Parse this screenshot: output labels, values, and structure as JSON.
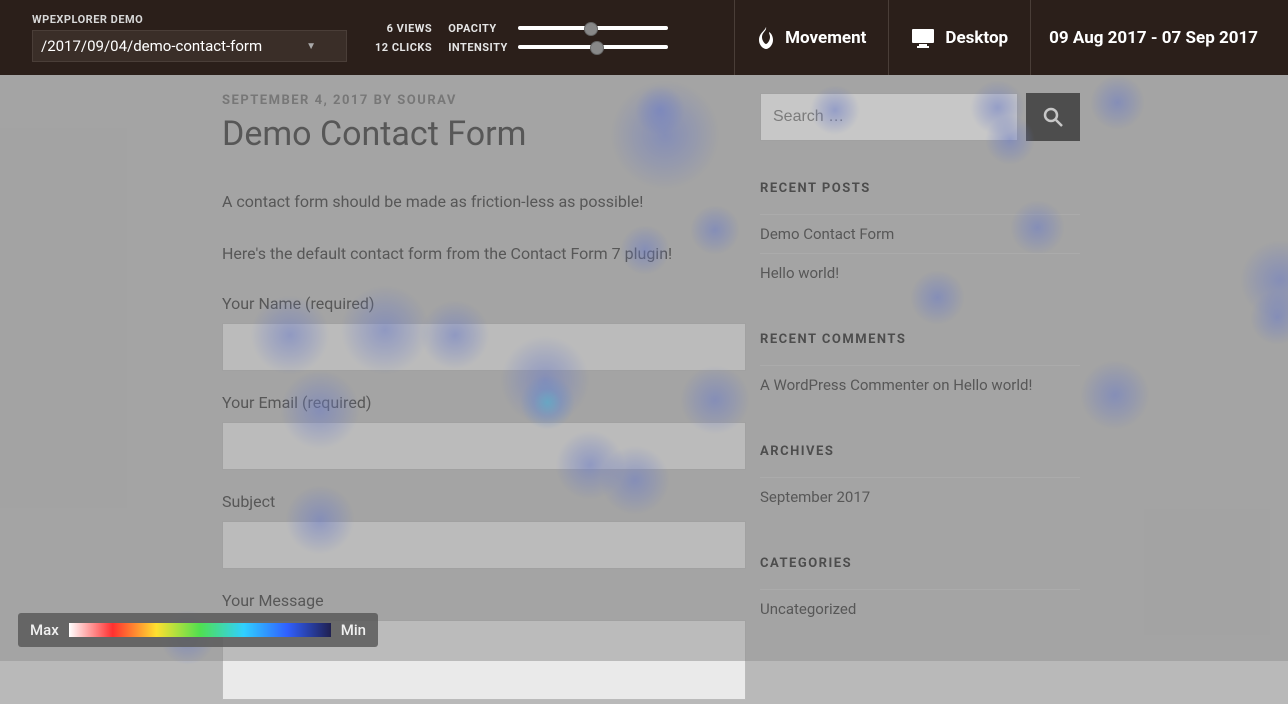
{
  "topbar": {
    "site_label": "WPEXPLORER DEMO",
    "url": "/2017/09/04/demo-contact-form",
    "stats": {
      "views": "6 VIEWS",
      "clicks": "12 CLICKS"
    },
    "sliders": {
      "opacity_label": "OPACITY",
      "intensity_label": "INTENSITY"
    },
    "movement_label": "Movement",
    "desktop_label": "Desktop",
    "date_range": "09 Aug 2017 - 07 Sep 2017"
  },
  "post": {
    "meta": "SEPTEMBER 4, 2017 BY SOURAV",
    "title": "Demo Contact Form",
    "p1": "A contact form should be made as friction-less as possible!",
    "p2": "Here's the default contact form from the Contact Form 7 plugin!",
    "name_label": "Your Name (required)",
    "email_label": "Your Email (required)",
    "subject_label": "Subject",
    "message_label": "Your Message"
  },
  "sidebar": {
    "search_placeholder": "Search …",
    "recent_posts_title": "RECENT POSTS",
    "recent_posts": [
      "Demo Contact Form",
      "Hello world!"
    ],
    "recent_comments_title": "RECENT COMMENTS",
    "recent_comment": "A WordPress Commenter on Hello world!",
    "archives_title": "ARCHIVES",
    "archives": [
      "September 2017"
    ],
    "categories_title": "CATEGORIES",
    "categories": [
      "Uncategorized"
    ]
  },
  "legend": {
    "max": "Max",
    "min": "Min"
  }
}
